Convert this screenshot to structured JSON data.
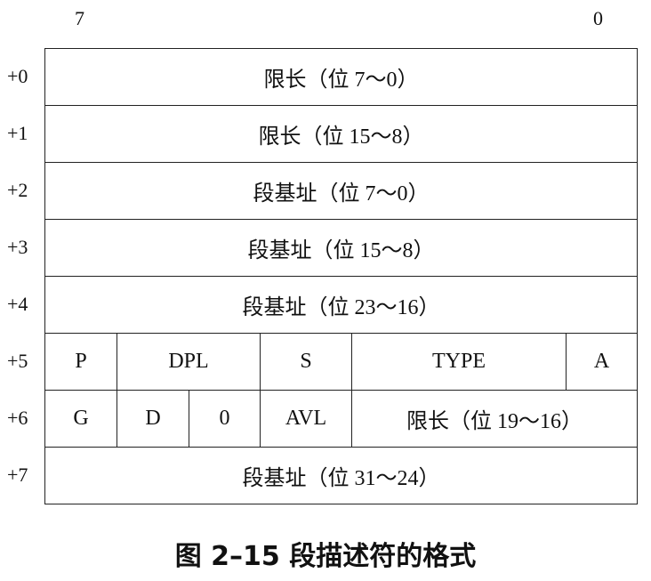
{
  "bit_labels": {
    "high": "7",
    "low": "0"
  },
  "rows": [
    {
      "offset": "+0",
      "cells": [
        "限长（位 7～0）"
      ]
    },
    {
      "offset": "+1",
      "cells": [
        "限长（位 15～8）"
      ]
    },
    {
      "offset": "+2",
      "cells": [
        "段基址（位 7～0）"
      ]
    },
    {
      "offset": "+3",
      "cells": [
        "段基址（位 15～8）"
      ]
    },
    {
      "offset": "+4",
      "cells": [
        "段基址（位 23～16）"
      ]
    },
    {
      "offset": "+5",
      "cells": [
        "P",
        "DPL",
        "S",
        "TYPE",
        "A"
      ]
    },
    {
      "offset": "+6",
      "cells": [
        "G",
        "D",
        "0",
        "AVL",
        "限长（位 19～16）"
      ]
    },
    {
      "offset": "+7",
      "cells": [
        "段基址（位 31～24）"
      ]
    }
  ],
  "caption": "图 2–15    段描述符的格式"
}
